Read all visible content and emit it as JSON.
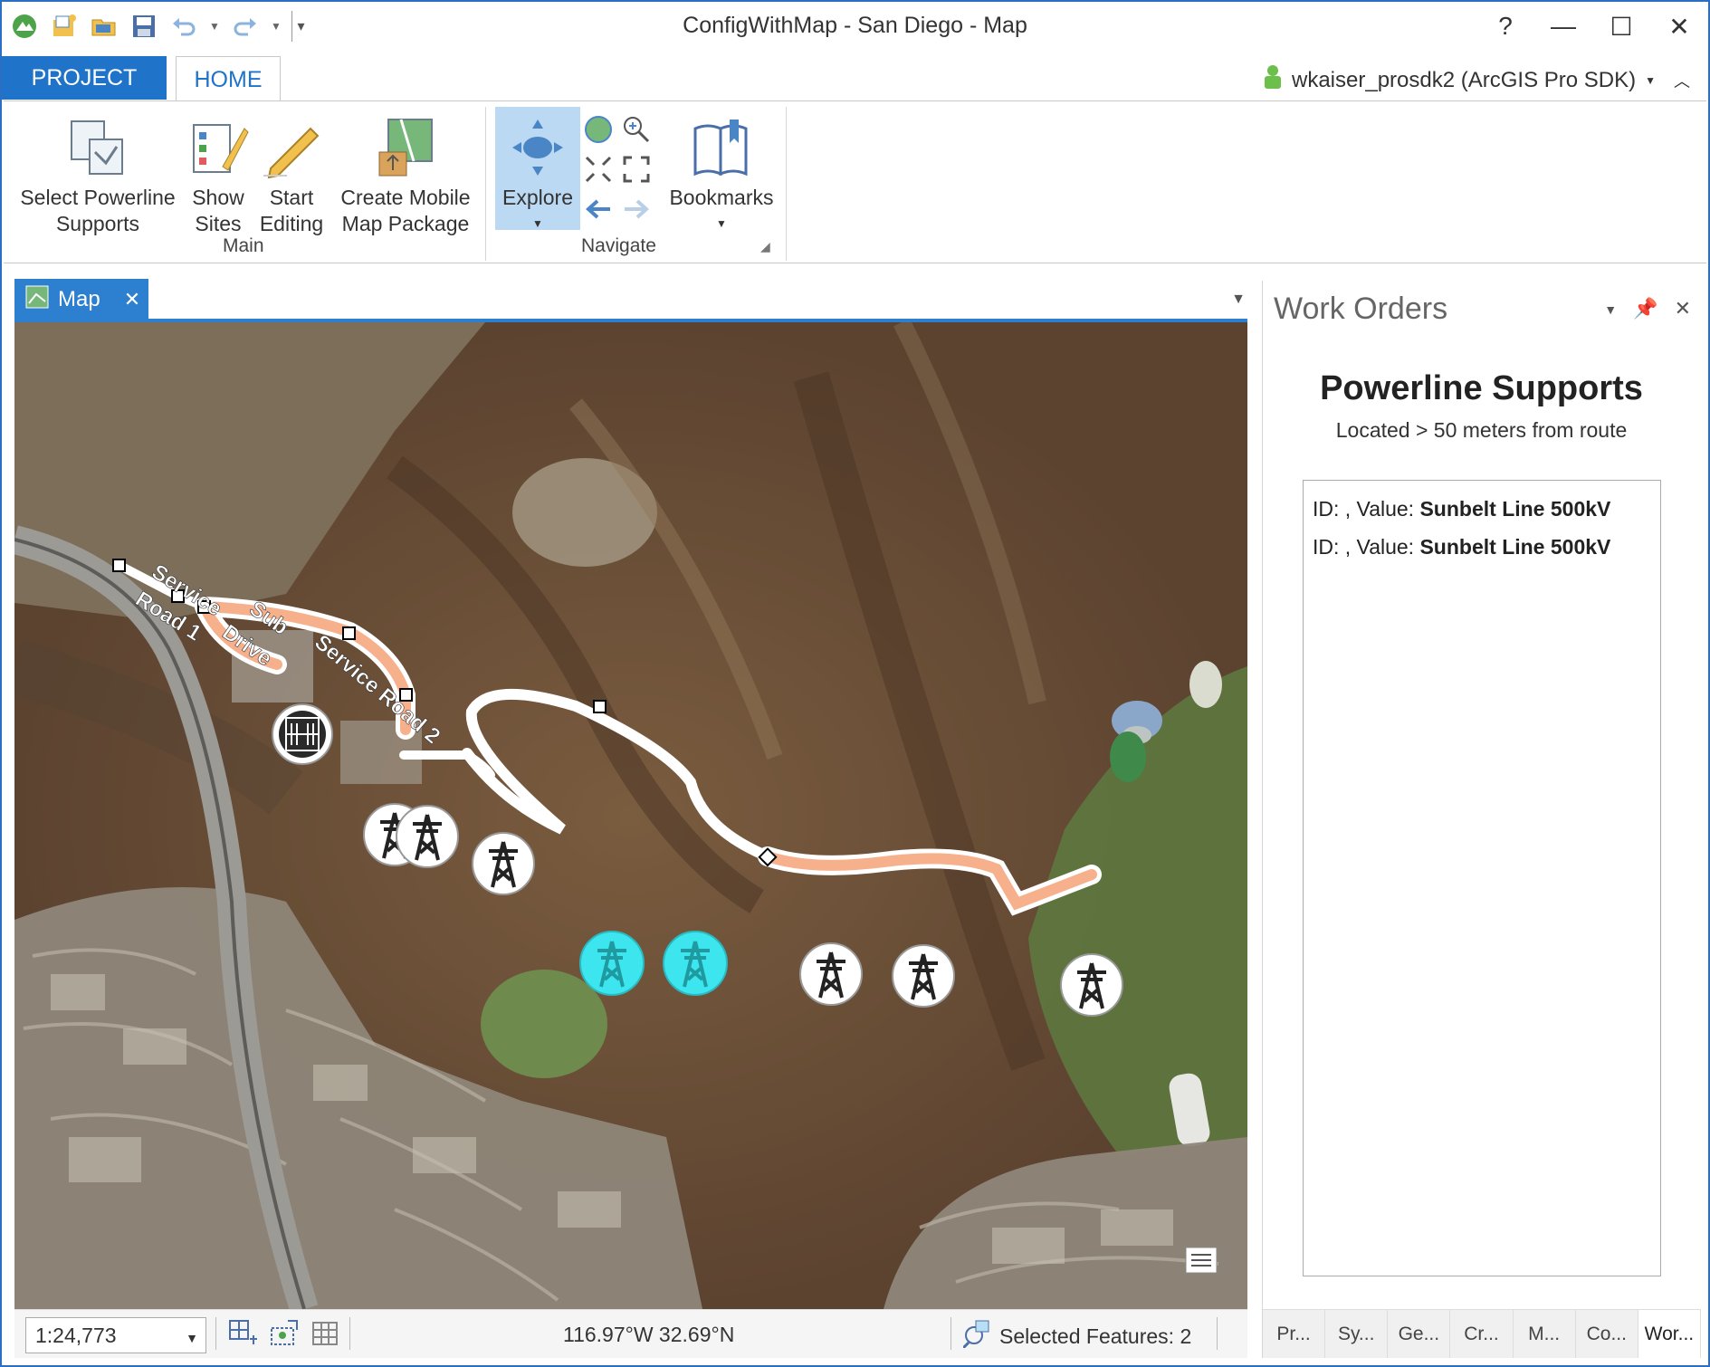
{
  "window": {
    "title": "ConfigWithMap - San Diego - Map",
    "controls": {
      "help": "?",
      "minimize": "—",
      "maximize": "☐",
      "close": "✕"
    }
  },
  "quick_access": [
    "app-icon",
    "new-project-icon",
    "open-icon",
    "save-icon",
    "undo-icon",
    "redo-icon",
    "customize-icon"
  ],
  "ribbon_tabs": {
    "project": "PROJECT",
    "home": "HOME"
  },
  "user": {
    "name": "wkaiser_prosdk2 (ArcGIS Pro SDK)"
  },
  "ribbon": {
    "main_group": {
      "label": "Main",
      "buttons": [
        {
          "line1": "Select Powerline",
          "line2": "Supports"
        },
        {
          "line1": "Show",
          "line2": "Sites"
        },
        {
          "line1": "Start",
          "line2": "Editing"
        },
        {
          "line1": "Create Mobile",
          "line2": "Map Package"
        }
      ]
    },
    "navigate_group": {
      "label": "Navigate",
      "explore": "Explore",
      "bookmarks": "Bookmarks"
    }
  },
  "map_tab": {
    "label": "Map"
  },
  "map": {
    "road_labels": [
      "Service",
      "Road 1",
      "Sub",
      "Drive",
      "Service Road 2"
    ],
    "colors": {
      "route": "#f6b08c",
      "road": "#ffffff",
      "selected": "#3de6ee"
    }
  },
  "status": {
    "scale": "1:24,773",
    "coordinates": "116.97°W 32.69°N",
    "selected_features": "Selected Features: 2"
  },
  "work_orders": {
    "title": "Work Orders",
    "heading": "Powerline Supports",
    "subheading": "Located > 50 meters from route",
    "items": [
      {
        "prefix": "ID: , Value: ",
        "value": "Sunbelt Line 500kV"
      },
      {
        "prefix": "ID: , Value: ",
        "value": "Sunbelt Line 500kV"
      }
    ],
    "bottom_tabs": [
      "Pr...",
      "Sy...",
      "Ge...",
      "Cr...",
      "M...",
      "Co...",
      "Wor..."
    ]
  }
}
